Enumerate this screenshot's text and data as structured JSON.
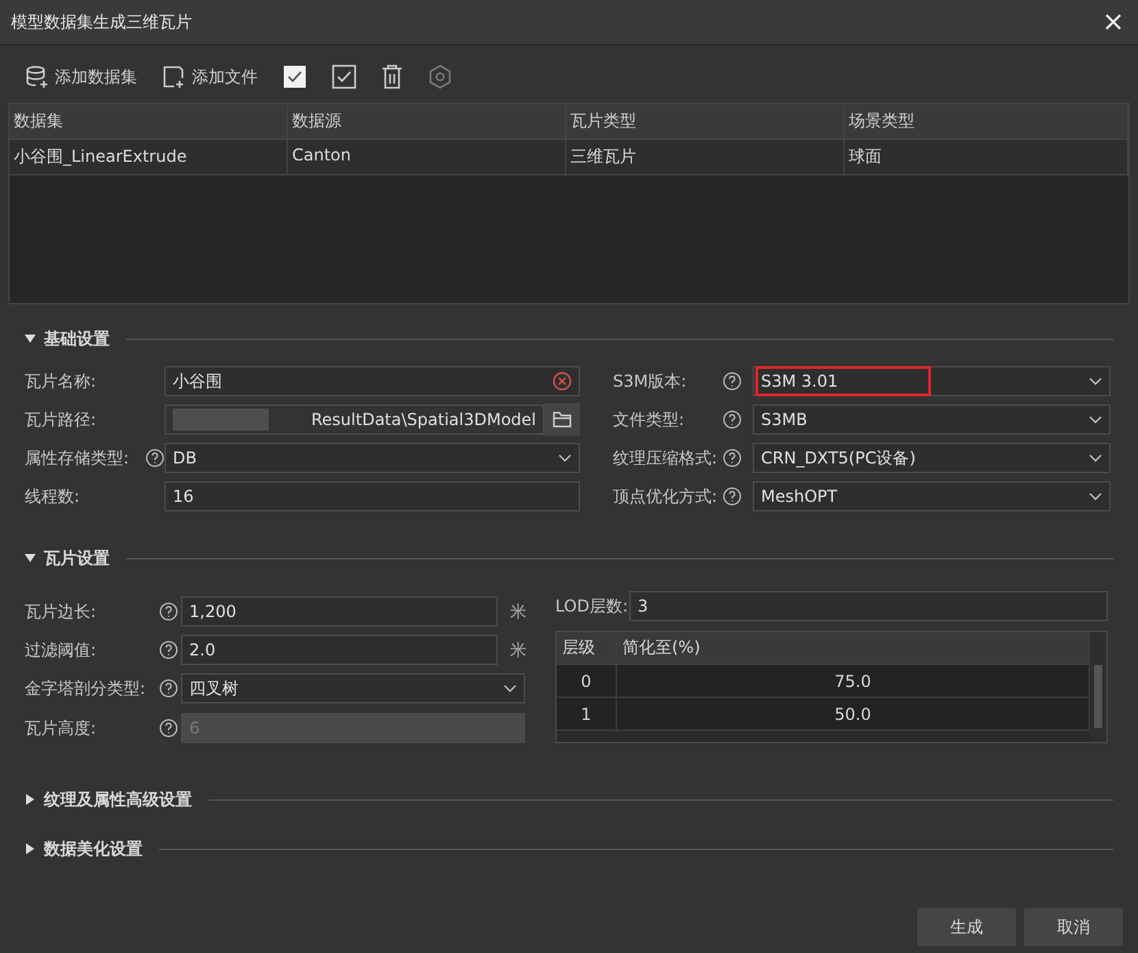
{
  "window": {
    "title": "模型数据集生成三维瓦片"
  },
  "toolbar": [
    {
      "kind": "add-dataset",
      "label": "添加数据集",
      "disabled": false
    },
    {
      "kind": "add-file",
      "label": "添加文件",
      "disabled": false
    },
    {
      "kind": "select-all",
      "disabled": false
    },
    {
      "kind": "check",
      "disabled": false
    },
    {
      "kind": "delete",
      "disabled": false
    },
    {
      "kind": "settings",
      "disabled": true
    }
  ],
  "dataset_table": {
    "columns": [
      "数据集",
      "数据源",
      "瓦片类型",
      "场景类型"
    ],
    "rows": [
      {
        "cells": [
          "小谷围_LinearExtrude",
          "Canton",
          "三维瓦片",
          "球面"
        ]
      }
    ]
  },
  "basic_settings": {
    "title": "基础设置",
    "expanded": true,
    "left_fields": [
      {
        "label": "瓦片名称:",
        "help": false,
        "kind": "clearable",
        "value": "小谷围"
      },
      {
        "label": "瓦片路径:",
        "help": false,
        "kind": "path",
        "value": "ResultData\\Spatial3DModel"
      },
      {
        "label": "属性存储类型:",
        "help": true,
        "kind": "select",
        "value": "DB"
      },
      {
        "label": "线程数:",
        "help": false,
        "kind": "text",
        "value": "16"
      }
    ],
    "right_fields": [
      {
        "label": "S3M版本:",
        "help": true,
        "kind": "select",
        "value": "S3M 3.01",
        "highlighted": true
      },
      {
        "label": "文件类型:",
        "help": true,
        "kind": "select",
        "value": "S3MB",
        "highlighted": false
      },
      {
        "label": "纹理压缩格式:",
        "help": true,
        "kind": "select",
        "value": "CRN_DXT5(PC设备)",
        "highlighted": false
      },
      {
        "label": "顶点优化方式:",
        "help": true,
        "kind": "select",
        "value": "MeshOPT",
        "highlighted": false
      }
    ]
  },
  "tile_settings": {
    "title": "瓦片设置",
    "expanded": true,
    "fields": [
      {
        "label": "瓦片边长:",
        "kind": "text",
        "value": "1,200",
        "unit": "米"
      },
      {
        "label": "过滤阈值:",
        "kind": "text",
        "value": "2.0",
        "unit": "米"
      },
      {
        "label": "金字塔剖分类型:",
        "kind": "select",
        "value": "四叉树"
      },
      {
        "label": "瓦片高度:",
        "kind": "disabled",
        "value": "6"
      }
    ],
    "lod": {
      "label": "LOD层数:",
      "value": "3",
      "columns": [
        "层级",
        "简化至(%)"
      ],
      "rows": [
        [
          "0",
          "75.0"
        ],
        [
          "1",
          "50.0"
        ]
      ]
    }
  },
  "collapsed_sections": [
    {
      "title": "纹理及属性高级设置",
      "expanded": false
    },
    {
      "title": "数据美化设置",
      "expanded": false
    }
  ],
  "buttons": [
    {
      "label": "生成"
    },
    {
      "label": "取消"
    }
  ]
}
